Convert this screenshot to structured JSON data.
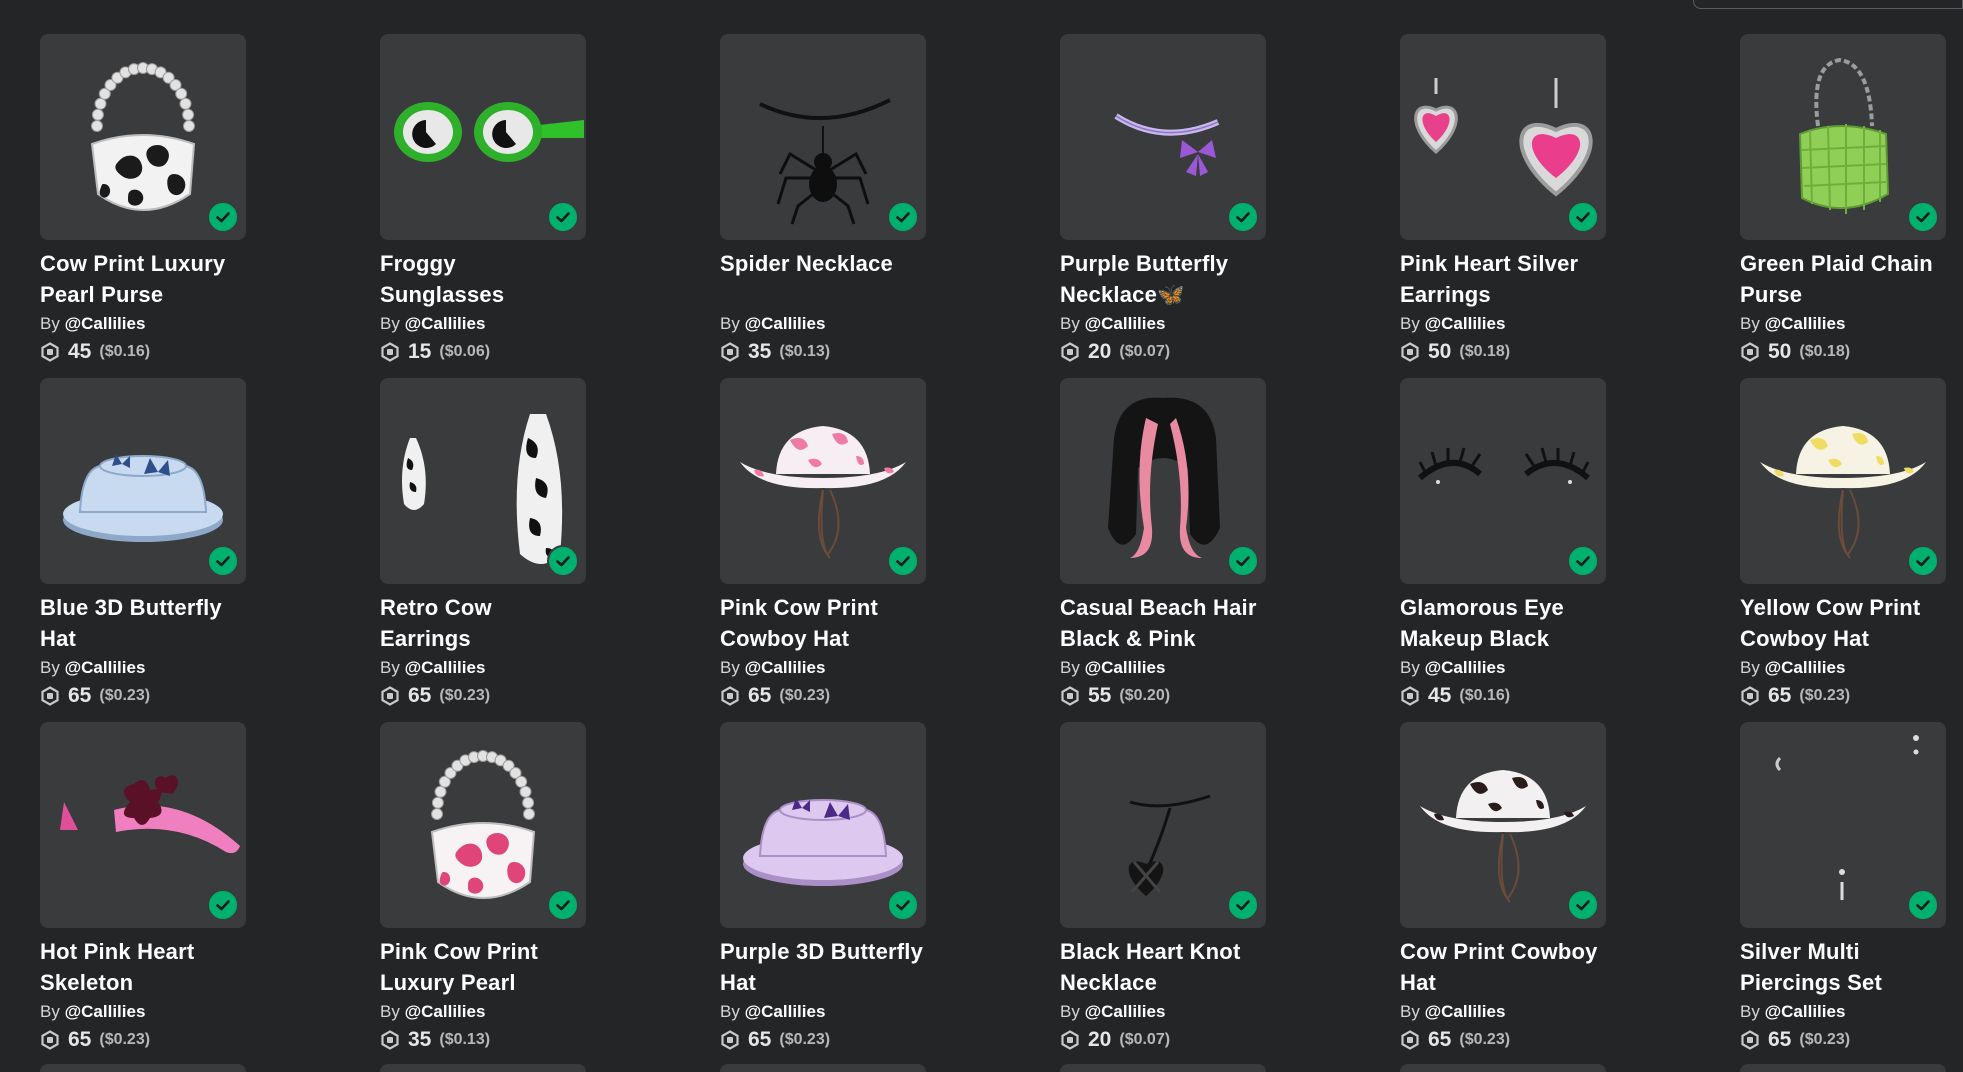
{
  "by_prefix": "By",
  "currency_icon": "robux-icon",
  "accent_owned": "#00b06f",
  "items": [
    {
      "name": "Cow Print Luxury Pearl Purse",
      "creator": "@Callilies",
      "price": "45",
      "usd": "($0.16)",
      "icon": "cow-print-purse-icon"
    },
    {
      "name": "Froggy Sunglasses",
      "creator": "@Callilies",
      "price": "15",
      "usd": "($0.06)",
      "icon": "frog-glasses-icon"
    },
    {
      "name": "Spider Necklace",
      "creator": "@Callilies",
      "price": "35",
      "usd": "($0.13)",
      "icon": "spider-necklace-icon"
    },
    {
      "name": "Purple Butterfly Necklace🦋",
      "creator": "@Callilies",
      "price": "20",
      "usd": "($0.07)",
      "icon": "butterfly-necklace-icon"
    },
    {
      "name": "Pink Heart Silver Earrings",
      "creator": "@Callilies",
      "price": "50",
      "usd": "($0.18)",
      "icon": "heart-earrings-icon"
    },
    {
      "name": "Green Plaid Chain Purse",
      "creator": "@Callilies",
      "price": "50",
      "usd": "($0.18)",
      "icon": "green-purse-icon"
    },
    {
      "name": "Blue 3D Butterfly Hat",
      "creator": "@Callilies",
      "price": "65",
      "usd": "($0.23)",
      "icon": "blue-bucket-hat-icon"
    },
    {
      "name": "Retro Cow Earrings",
      "creator": "@Callilies",
      "price": "65",
      "usd": "($0.23)",
      "icon": "cow-earrings-icon"
    },
    {
      "name": "Pink Cow Print Cowboy Hat",
      "creator": "@Callilies",
      "price": "65",
      "usd": "($0.23)",
      "icon": "pink-cowboy-hat-icon"
    },
    {
      "name": "Casual Beach Hair Black & Pink",
      "creator": "@Callilies",
      "price": "55",
      "usd": "($0.20)",
      "icon": "hair-icon"
    },
    {
      "name": "Glamorous Eye Makeup Black",
      "creator": "@Callilies",
      "price": "45",
      "usd": "($0.16)",
      "icon": "eyelashes-icon"
    },
    {
      "name": "Yellow Cow Print Cowboy Hat",
      "creator": "@Callilies",
      "price": "65",
      "usd": "($0.23)",
      "icon": "yellow-cowboy-hat-icon"
    },
    {
      "name": "Hot Pink Heart Skeleton",
      "creator": "@Callilies",
      "price": "65",
      "usd": "($0.23)",
      "icon": "pink-hair-clips-icon"
    },
    {
      "name": "Pink Cow Print Luxury Pearl",
      "creator": "@Callilies",
      "price": "35",
      "usd": "($0.13)",
      "icon": "pink-cow-purse-icon"
    },
    {
      "name": "Purple 3D Butterfly Hat",
      "creator": "@Callilies",
      "price": "65",
      "usd": "($0.23)",
      "icon": "purple-bucket-hat-icon"
    },
    {
      "name": "Black Heart Knot Necklace",
      "creator": "@Callilies",
      "price": "20",
      "usd": "($0.07)",
      "icon": "heart-knot-necklace-icon"
    },
    {
      "name": "Cow Print Cowboy Hat",
      "creator": "@Callilies",
      "price": "65",
      "usd": "($0.23)",
      "icon": "cow-cowboy-hat-icon"
    },
    {
      "name": "Silver Multi Piercings Set",
      "creator": "@Callilies",
      "price": "65",
      "usd": "($0.23)",
      "icon": "piercings-icon"
    }
  ]
}
